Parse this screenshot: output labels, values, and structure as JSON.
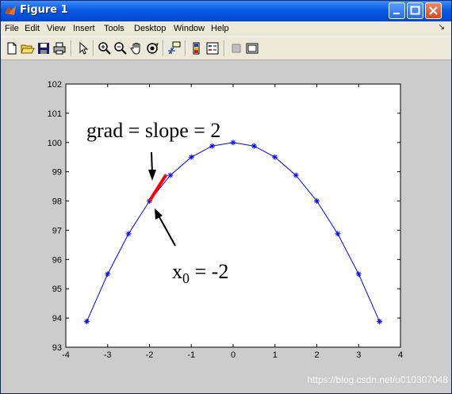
{
  "window": {
    "title": "Figure 1"
  },
  "menubar": {
    "items": [
      "File",
      "Edit",
      "View",
      "Insert",
      "Tools",
      "Desktop",
      "Window",
      "Help"
    ]
  },
  "toolbar": {
    "icons": [
      "new-file-icon",
      "open-folder-icon",
      "save-icon",
      "print-icon",
      "pointer-icon",
      "zoom-in-icon",
      "zoom-out-icon",
      "pan-hand-icon",
      "rotate-3d-icon",
      "data-cursor-icon",
      "colorbar-icon",
      "legend-icon",
      "hide-plot-tools-icon",
      "show-plot-tools-icon"
    ]
  },
  "chart_data": {
    "type": "line",
    "title": "",
    "xlabel": "",
    "ylabel": "",
    "xlim": [
      -4,
      4
    ],
    "ylim": [
      93,
      102
    ],
    "x_ticks": [
      "-4",
      "-3",
      "-2",
      "-1",
      "0",
      "1",
      "2",
      "3",
      "4"
    ],
    "y_ticks": [
      "93",
      "94",
      "95",
      "96",
      "97",
      "98",
      "99",
      "100",
      "101",
      "102"
    ],
    "series": [
      {
        "color": "#0000ff",
        "marker": "*",
        "x": [
          -3.5,
          -3,
          -2.5,
          -2,
          -1.5,
          -1,
          -0.5,
          0,
          0.5,
          1,
          1.5,
          2,
          2.5,
          3,
          3.5
        ],
        "y": [
          93.88,
          95.5,
          96.88,
          98,
          98.88,
          99.5,
          99.88,
          100,
          99.88,
          99.5,
          98.88,
          98,
          96.88,
          95.5,
          93.88
        ]
      },
      {
        "color": "#ff0000",
        "x": [
          -2,
          -1.6
        ],
        "y": [
          98,
          98.9
        ]
      }
    ],
    "annotations": {
      "slope_text": "grad = slope = 2",
      "x0_base": "x",
      "x0_sub": "0",
      "x0_rest": " = -2"
    }
  },
  "watermark": "https://blog.csdn.net/u010307048"
}
